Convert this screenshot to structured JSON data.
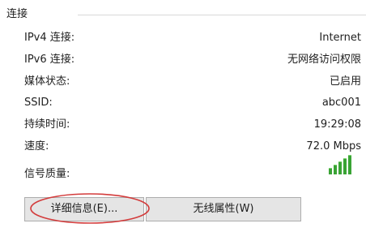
{
  "group": {
    "title": "连接"
  },
  "rows": [
    {
      "label": "IPv4 连接:",
      "value": "Internet"
    },
    {
      "label": "IPv6 连接:",
      "value": "无网络访问权限"
    },
    {
      "label": "媒体状态:",
      "value": "已启用"
    },
    {
      "label": "SSID:",
      "value": "abc001"
    },
    {
      "label": "持续时间:",
      "value": "19:29:08"
    },
    {
      "label": "速度:",
      "value": "72.0 Mbps"
    }
  ],
  "signal": {
    "label": "信号质量:",
    "icon": "signal-strength-icon",
    "level": 5,
    "max_level": 5,
    "color": "#3aa335"
  },
  "buttons": {
    "details": "详细信息(E)...",
    "wireless_properties": "无线属性(W)"
  },
  "annotation": {
    "color": "#d33b3b"
  }
}
